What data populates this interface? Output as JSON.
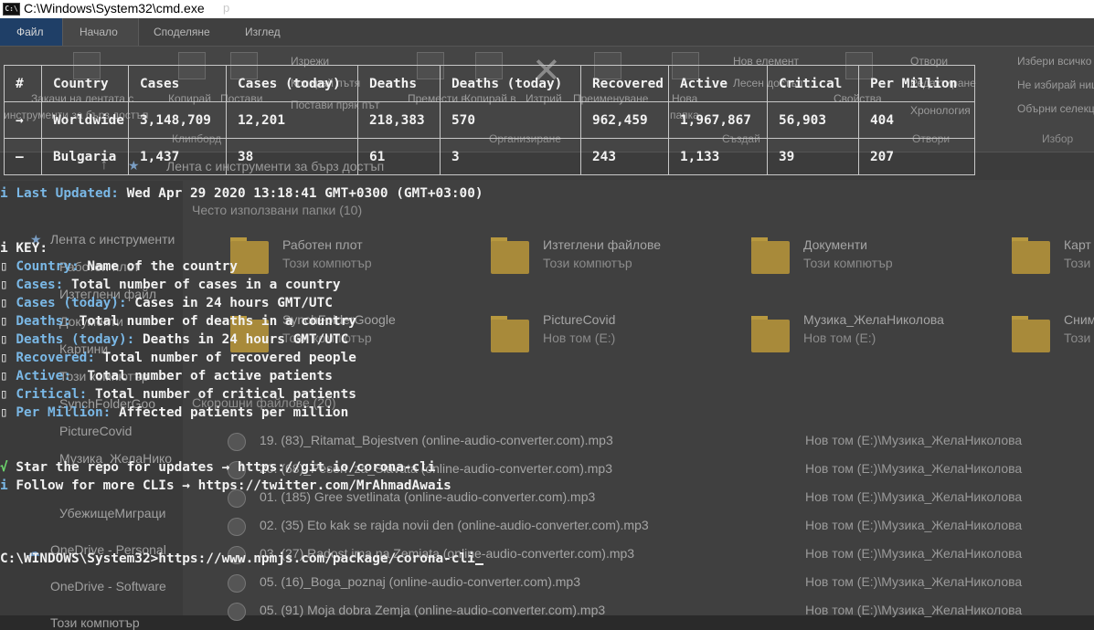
{
  "window": {
    "title": "C:\\Windows\\System32\\cmd.exe",
    "title_ghost": "р",
    "icon": "cmd-icon"
  },
  "explorer": {
    "tabs": [
      "Файл",
      "Начало",
      "Споделяне",
      "Изглед"
    ],
    "ribbon": {
      "pin_label_1": "Закачи на лентата с",
      "pin_label_2": "инструменти за бърз достъп",
      "copy": "Копирай",
      "paste": "Постави",
      "cut": "Изрежи",
      "copy_path": "Копирай пътя",
      "paste_shortcut": "Постави пряк път",
      "move_to": "Премести в",
      "copy_to": "Копирай в",
      "delete": "Изтрий",
      "rename": "Преименуване",
      "new_folder_1": "Нова",
      "new_folder_2": "папка",
      "new_item": "Нов елемент",
      "easy_access": "Лесен достъп",
      "properties": "Свойства",
      "open": "Отвори",
      "edit": "Редактиране",
      "history": "Хронология",
      "select_all": "Избери всичко",
      "select_none": "Не избирай нищо",
      "invert_selection": "Обърни селекцията",
      "groups": [
        "Клипборд",
        "Организиране",
        "Създай",
        "Отвори",
        "Избор"
      ]
    },
    "address": "Лента с инструменти за бърз достъп",
    "nav_pane": [
      "Лента с инструменти",
      "Работен плот",
      "Изтеглени файл",
      "Документи",
      "Картини",
      "Този компютър",
      "SynchFolderGoo",
      "PictureCovid",
      "Музика_ЖелаНико",
      "УбежищеМиграци",
      "OneDrive - Personal",
      "OneDrive - Software",
      "Този компютър"
    ],
    "frequent_header": "Често използвани папки (10)",
    "frequent": [
      {
        "name": "Работен плот",
        "sub": "Този компютър"
      },
      {
        "name": "Изтеглени файлове",
        "sub": "Този компютър"
      },
      {
        "name": "Документи",
        "sub": "Този компютър"
      },
      {
        "name": "Карт",
        "sub": "Този"
      },
      {
        "name": "SynchFolderGoogle",
        "sub": "Този компютър"
      },
      {
        "name": "PictureCovid",
        "sub": "Нов том (E:)"
      },
      {
        "name": "Музика_ЖелаНиколова",
        "sub": "Нов том (E:)"
      },
      {
        "name": "Сним",
        "sub": "Този"
      }
    ],
    "recent_header": "Скорошни файлове (20)",
    "recent": [
      {
        "name": "19. (83)_Ritamat_Bojestven (online-audio-converter.com).mp3",
        "path": "Нов том (E:)\\Музика_ЖелаНиколова"
      },
      {
        "name": "20. (68)_Pesen_za_Slavata (online-audio-converter.com).mp3",
        "path": "Нов том (E:)\\Музика_ЖелаНиколова"
      },
      {
        "name": "01. (185) Gree svetlinata (online-audio-converter.com).mp3",
        "path": "Нов том (E:)\\Музика_ЖелаНиколова"
      },
      {
        "name": "02. (35) Eto kak se rajda novii den (online-audio-converter.com).mp3",
        "path": "Нов том (E:)\\Музика_ЖелаНиколова"
      },
      {
        "name": "03. (27) Radost ima na Zemiata (online-audio-converter.com).mp3",
        "path": "Нов том (E:)\\Музика_ЖелаНиколова"
      },
      {
        "name": "05. (16)_Boga_poznaj (online-audio-converter.com).mp3",
        "path": "Нов том (E:)\\Музика_ЖелаНиколова"
      },
      {
        "name": "05. (91) Moja dobra Zemja (online-audio-converter.com).mp3",
        "path": "Нов том (E:)\\Музика_ЖелаНиколова"
      }
    ]
  },
  "terminal": {
    "table": {
      "headers": [
        "#",
        "Country",
        "Cases",
        "Cases (today)",
        "Deaths",
        "Deaths (today)",
        "Recovered",
        "Active",
        "Critical",
        "Per Million"
      ],
      "rows": [
        [
          "→",
          "Worldwide",
          "3,148,709",
          "12,201",
          "218,383",
          "570",
          "962,459",
          "1,967,867",
          "56,903",
          "404"
        ],
        [
          "—",
          "Bulgaria",
          "1,437",
          "38",
          "61",
          "3",
          "243",
          "1,133",
          "39",
          "207"
        ]
      ]
    },
    "last_updated_prefix": "i",
    "last_updated_label": "Last Updated:",
    "last_updated_value": "Wed Apr 29 2020 13:18:41 GMT+0300 (GMT+03:00)",
    "key_title": "i KEY:",
    "key_bullet": "▯",
    "key": [
      {
        "term": "Country:",
        "desc": " Name of the country"
      },
      {
        "term": "Cases:",
        "desc": " Total number of cases in a country"
      },
      {
        "term": "Cases (today):",
        "desc": " Cases in 24 hours GMT/UTC"
      },
      {
        "term": "Deaths:",
        "desc": " Total number of deaths in a country"
      },
      {
        "term": "Deaths (today):",
        "desc": " Deaths in 24 hours GMT/UTC"
      },
      {
        "term": "Recovered:",
        "desc": " Total number of recovered people"
      },
      {
        "term": "Active:",
        "desc": "  Total number of active patients"
      },
      {
        "term": "Critical:",
        "desc": " Total number of critical patients"
      },
      {
        "term": "Per Million:",
        "desc": " Affected patients per million"
      }
    ],
    "star_mark": "√",
    "star_line": " Star the repo for updates → https://git.io/corona-cli",
    "follow_mark": "i",
    "follow_line": " Follow for more CLIs → https://twitter.com/MrAhmadAwais",
    "prompt": "C:\\WINDOWS\\System32>",
    "command": "https://www.npmjs.com/package/corona-cli"
  },
  "colors": {
    "blue": "#7ab8e6",
    "red": "#e9564f",
    "green": "#6cd66c",
    "yellow": "#e6d24a",
    "text": "#f2f2f2"
  }
}
